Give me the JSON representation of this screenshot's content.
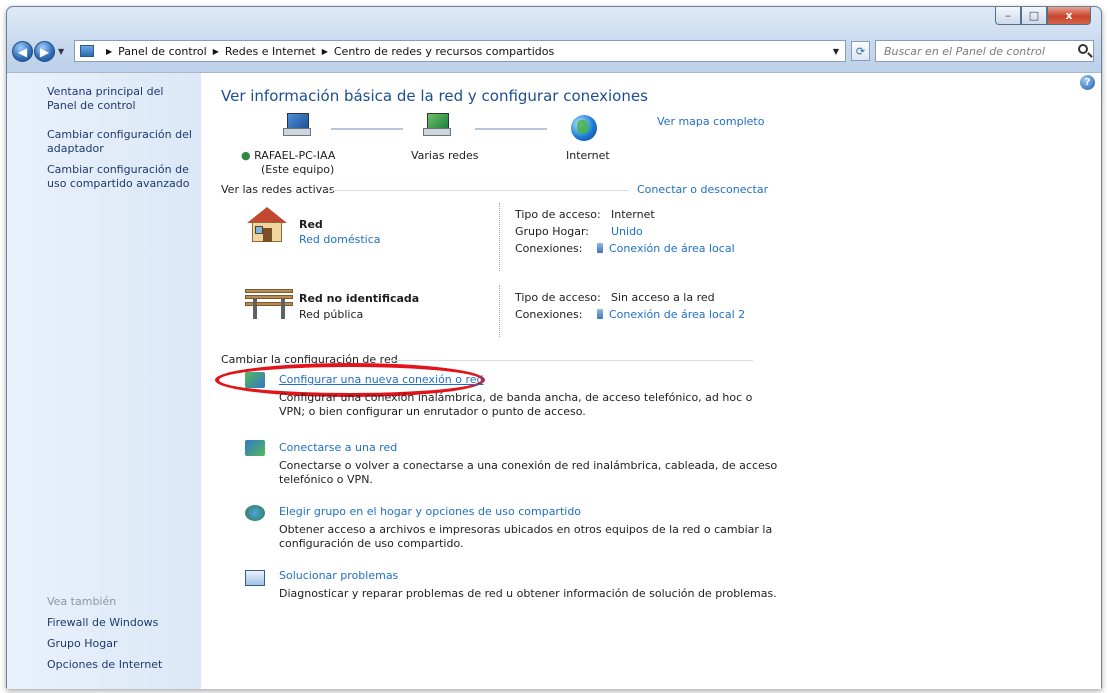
{
  "window": {
    "buttons": {
      "minimize": "–",
      "maximize": "□",
      "close": "x"
    }
  },
  "navbar": {
    "breadcrumbs": [
      "Panel de control",
      "Redes e Internet",
      "Centro de redes y recursos compartidos"
    ],
    "search_placeholder": "Buscar en el Panel de control"
  },
  "sidebar": {
    "items": [
      "Ventana principal del Panel de control",
      "Cambiar configuración del adaptador",
      "Cambiar configuración de uso compartido avanzado"
    ],
    "see_also_title": "Vea también",
    "see_also": [
      "Firewall de Windows",
      "Grupo Hogar",
      "Opciones de Internet"
    ]
  },
  "main": {
    "title": "Ver información básica de la red y configurar conexiones",
    "map_link": "Ver mapa completo",
    "map": {
      "computer_name": "RAFAEL-PC-IAA",
      "computer_sub": "(Este equipo)",
      "networks": "Varias redes",
      "internet": "Internet"
    },
    "active_title": "Ver las redes activas",
    "connect_link": "Conectar o desconectar",
    "networks": [
      {
        "name": "Red",
        "type": "Red doméstica",
        "type_is_link": true,
        "access_label": "Tipo de acceso:",
        "access_value": "Internet",
        "homegroup_label": "Grupo Hogar:",
        "homegroup_value": "Unido",
        "connections_label": "Conexiones:",
        "connections_value": "Conexión de área local"
      },
      {
        "name": "Red no identificada",
        "type": "Red pública",
        "type_is_link": false,
        "access_label": "Tipo de acceso:",
        "access_value": "Sin acceso a la red",
        "connections_label": "Conexiones:",
        "connections_value": "Conexión de área local 2"
      }
    ],
    "change_title": "Cambiar la configuración de red",
    "tasks": [
      {
        "link": "Configurar una nueva conexión o red",
        "desc": "Configurar una conexión inalámbrica, de banda ancha, de acceso telefónico, ad hoc o VPN; o bien configurar un enrutador o punto de acceso."
      },
      {
        "link": "Conectarse a una red",
        "desc": "Conectarse o volver a conectarse a una conexión de red inalámbrica, cableada, de acceso telefónico o VPN."
      },
      {
        "link": "Elegir grupo en el hogar y opciones de uso compartido",
        "desc": "Obtener acceso a archivos e impresoras ubicados en otros equipos de la red o cambiar la configuración de uso compartido."
      },
      {
        "link": "Solucionar problemas",
        "desc": "Diagnosticar y reparar problemas de red u obtener información de solución de problemas."
      }
    ]
  }
}
